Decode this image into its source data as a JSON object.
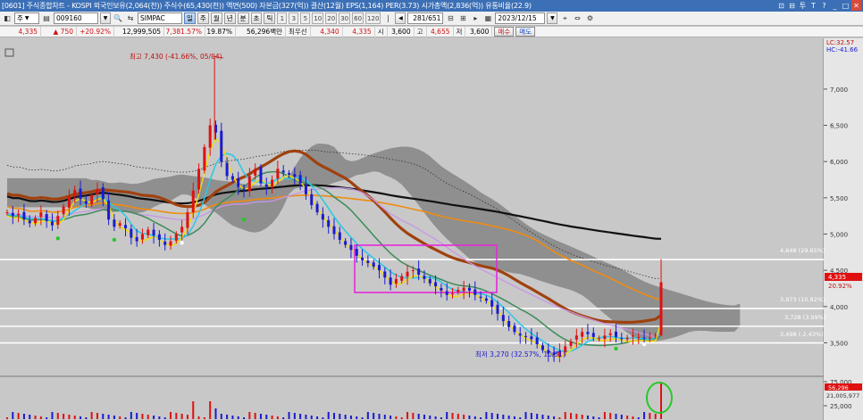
{
  "title": "[0601] 주식종합차트 - KOSPI 외국인보유(2,064(천)) 주식수(65,430(천)) 액면(500) 자본금(327(억)) 결산(12월) EPS(1,164) PER(3.73) 시가총액(2,836(억)) 유통비율(22.9)",
  "window_controls": [
    "⊡",
    "⊟",
    "투",
    "T",
    "?",
    "_",
    "□",
    "✕"
  ],
  "toolbar": {
    "period_select": "주",
    "code": "009160",
    "name": "SIMPAC",
    "period_buttons": [
      "일",
      "주",
      "월",
      "년",
      "분",
      "초",
      "틱"
    ],
    "active_period": "일",
    "minute_buttons": [
      "1",
      "3",
      "5",
      "10",
      "20",
      "30",
      "60",
      "120"
    ],
    "page_counter": "281/651",
    "date": "2023/12/15"
  },
  "quote": {
    "price": "4,335",
    "change": "▲  750",
    "change_pct": "+20.92%",
    "volume": "12,999,505",
    "volume_ratio": "7,381.57%",
    "turnover": "19.87%",
    "amount": "56,296백만",
    "base_label": "최우선",
    "best_ask": "4,340",
    "best_bid": "4,335",
    "open_label": "시",
    "open": "3,600",
    "high_label": "고",
    "high": "4,655",
    "low_label": "저",
    "low": "3,600",
    "buy_label": "매수",
    "sell_label": "매도"
  },
  "legend": {
    "lc": "LC:32.57",
    "hc": "HC:-41.66"
  },
  "annotations": {
    "high": "최고 7,430 (-41.66%, 05/04)",
    "low": "최저 3,270 (32.57%, 10/31)",
    "level_1": "4,648 (29.65%)",
    "level_2": "3,973 (10.82%)",
    "level_3": "3,728 (3.99%)",
    "level_4": "3,498 (-2.43%)",
    "current_price": "4,335",
    "current_pct": "20.92%",
    "volume_current": "56,296",
    "volume_avg": "21,005,977"
  },
  "colors": {
    "up": "#e01010",
    "down": "#1a1ad0",
    "ichimoku_cloud": "#888888",
    "ma_black": "#111111",
    "ma_brown": "#a0410e",
    "ma_orange": "#f08c10",
    "ma_violet": "#c896e6",
    "ma_green": "#3c8c5a",
    "ma_cyan": "#28c8e6",
    "ma_yellow": "#f0dc14",
    "box_magenta": "#e628dc",
    "circle_green": "#28c828"
  },
  "chart_data": {
    "type": "candlestick",
    "y_ticks": [
      "7,000",
      "6,500",
      "6,000",
      "5,500",
      "5,000",
      "4,500",
      "4,000",
      "3,500"
    ],
    "volume_ticks": [
      "75,000",
      "25,000"
    ],
    "ylim": [
      3050,
      7700
    ],
    "price_levels": [
      4648,
      3973,
      3728,
      3498
    ],
    "high_point": {
      "value": 7430,
      "date": "05/04"
    },
    "low_point": {
      "value": 3270,
      "date": "10/31"
    },
    "last_close": 4335,
    "last_open": 3600,
    "last_high": 4655,
    "last_low": 3600,
    "closes": [
      5300,
      5250,
      5280,
      5200,
      5150,
      5220,
      5300,
      5180,
      5120,
      5250,
      5380,
      5520,
      5610,
      5480,
      5420,
      5540,
      5620,
      5480,
      5200,
      5100,
      5150,
      5080,
      4950,
      4900,
      5000,
      5060,
      4980,
      4920,
      4850,
      4900,
      5000,
      5100,
      5300,
      5600,
      5900,
      6200,
      6500,
      6400,
      6000,
      5800,
      5750,
      5650,
      5600,
      5800,
      5900,
      5700,
      5650,
      5750,
      5900,
      5850,
      5820,
      5790,
      5700,
      5550,
      5400,
      5300,
      5200,
      5100,
      5000,
      4920,
      4850,
      4780,
      4700,
      4640,
      4600,
      4550,
      4500,
      4400,
      4300,
      4380,
      4420,
      4480,
      4500,
      4440,
      4380,
      4320,
      4280,
      4220,
      4160,
      4180,
      4230,
      4260,
      4220,
      4160,
      4120,
      4080,
      4000,
      3900,
      3800,
      3720,
      3650,
      3600,
      3580,
      3550,
      3480,
      3400,
      3350,
      3330,
      3380,
      3450,
      3520,
      3600,
      3650,
      3620,
      3580,
      3560,
      3600,
      3630,
      3580,
      3550,
      3570,
      3600,
      3580,
      3560,
      3570,
      3600,
      4335
    ]
  }
}
